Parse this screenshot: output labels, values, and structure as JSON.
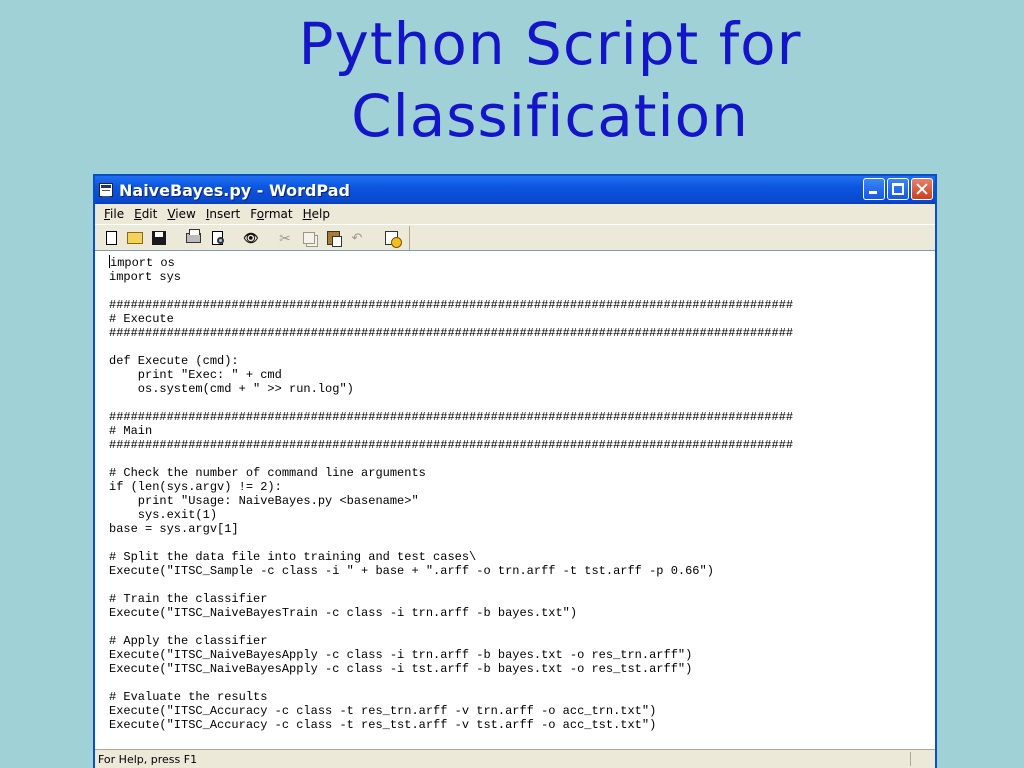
{
  "slide": {
    "title_line1": "Python Script for",
    "title_line2": "Classification"
  },
  "window": {
    "title": "NaiveBayes.py - WordPad",
    "app_icon": "wordpad-icon"
  },
  "menu": {
    "file": {
      "u": "F",
      "rest": "ile"
    },
    "edit": {
      "u": "E",
      "rest": "dit"
    },
    "view": {
      "u": "V",
      "rest": "iew"
    },
    "insert": {
      "pre": "",
      "u": "I",
      "rest": "nsert"
    },
    "format": {
      "pre": "F",
      "u": "o",
      "rest": "rmat"
    },
    "help": {
      "u": "H",
      "rest": "elp"
    }
  },
  "toolbar": {
    "icons": [
      "new-icon",
      "open-icon",
      "save-icon",
      "print-icon",
      "print-preview-icon",
      "find-icon",
      "cut-icon",
      "copy-icon",
      "paste-icon",
      "undo-icon",
      "date-time-icon"
    ]
  },
  "document": {
    "first_char": "i",
    "text_after_caret": "mport os\nimport sys\n\n###############################################################################################\n# Execute\n###############################################################################################\n\ndef Execute (cmd):\n    print \"Exec: \" + cmd\n    os.system(cmd + \" >> run.log\")\n\n###############################################################################################\n# Main\n###############################################################################################\n\n# Check the number of command line arguments\nif (len(sys.argv) != 2):\n    print \"Usage: NaiveBayes.py <basename>\"\n    sys.exit(1)\nbase = sys.argv[1]\n\n# Split the data file into training and test cases\\\nExecute(\"ITSC_Sample -c class -i \" + base + \".arff -o trn.arff -t tst.arff -p 0.66\")\n\n# Train the classifier\nExecute(\"ITSC_NaiveBayesTrain -c class -i trn.arff -b bayes.txt\")\n\n# Apply the classifier\nExecute(\"ITSC_NaiveBayesApply -c class -i trn.arff -b bayes.txt -o res_trn.arff\")\nExecute(\"ITSC_NaiveBayesApply -c class -i tst.arff -b bayes.txt -o res_tst.arff\")\n\n# Evaluate the results\nExecute(\"ITSC_Accuracy -c class -t res_trn.arff -v trn.arff -o acc_trn.txt\")\nExecute(\"ITSC_Accuracy -c class -t res_tst.arff -v tst.arff -o acc_tst.txt\")"
  },
  "status": {
    "text": "For Help, press F1"
  }
}
